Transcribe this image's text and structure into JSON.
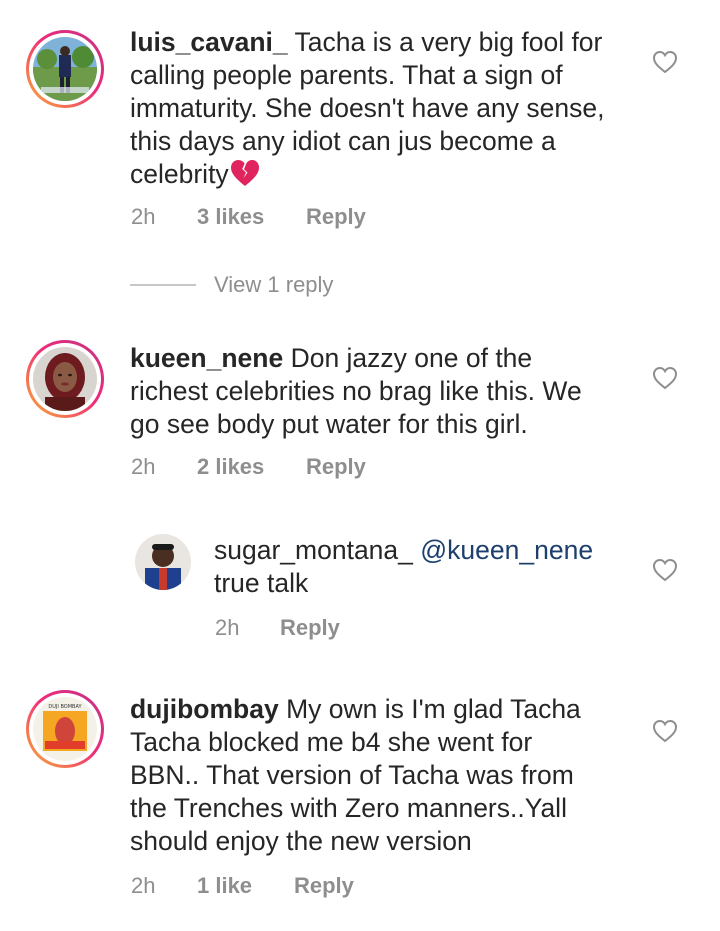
{
  "comments": [
    {
      "username": "luis_cavani_",
      "lines": [
        "Tacha is a very big fool for",
        "calling people parents. That a sign of",
        "immaturity. She doesn't have any sense,",
        "this days any idiot can jus become a",
        "celebrity"
      ],
      "emoji": "broken-heart",
      "time": "2h",
      "likes": "3 likes",
      "reply_label": "Reply",
      "view_replies": "View 1 reply"
    },
    {
      "username": "kueen_nene",
      "lines": [
        "Don jazzy one of the",
        "richest celebrities no brag like this.  We",
        "go see body put water for this girl."
      ],
      "time": "2h",
      "likes": "2 likes",
      "reply_label": "Reply",
      "replies": [
        {
          "username": "sugar_montana_",
          "mention": "@kueen_nene",
          "lines": [
            "true talk"
          ],
          "time": "2h",
          "reply_label": "Reply"
        }
      ]
    },
    {
      "username": "dujibombay",
      "lines": [
        "My own is I'm glad Tacha",
        "Tacha blocked me b4 she went for",
        "BBN.. That version  of Tacha was from",
        "the Trenches with Zero manners..Yall",
        "should enjoy the new version"
      ],
      "time": "2h",
      "likes": "1 like",
      "reply_label": "Reply",
      "avatar_text": "DUJI BOMBAY"
    }
  ],
  "icons": {
    "like": "heart-outline-icon",
    "emoji": "broken-heart-emoji"
  },
  "colors": {
    "text": "#262626",
    "meta": "#8e8e8e",
    "mention": "#1c3f6e",
    "story_ring_start": "#f9b233",
    "story_ring_end": "#c13584"
  }
}
